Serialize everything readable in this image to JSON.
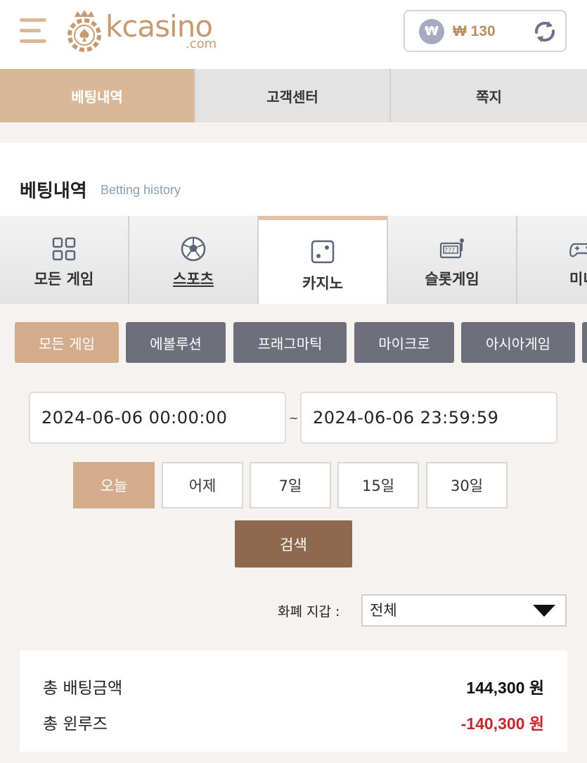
{
  "header": {
    "logo_text": "kcasino",
    "logo_sub": ".com",
    "wallet": {
      "currency_symbol": "₩",
      "amount": "₩ 130"
    }
  },
  "topnav": {
    "tabs": [
      {
        "label": "베팅내역",
        "active": true
      },
      {
        "label": "고객센터",
        "active": false
      },
      {
        "label": "쪽지",
        "active": false
      }
    ]
  },
  "section": {
    "title": "베팅내역",
    "subtitle": "Betting history"
  },
  "game_tabs": [
    {
      "label": "모든 게임",
      "icon": "grid-icon"
    },
    {
      "label": "스포츠",
      "icon": "soccer-ball-icon"
    },
    {
      "label": "카지노",
      "icon": "dice-icon",
      "active": true
    },
    {
      "label": "슬롯게임",
      "icon": "slot-machine-icon"
    },
    {
      "label": "미니",
      "icon": "gamepad-icon"
    }
  ],
  "providers": [
    {
      "label": "모든 게임",
      "active": true
    },
    {
      "label": "에볼루션"
    },
    {
      "label": "프래그마틱"
    },
    {
      "label": "마이크로"
    },
    {
      "label": "아시아게임"
    }
  ],
  "date_range": {
    "start": "2024-06-06 00:00:00",
    "separator": "~",
    "end": "2024-06-06 23:59:59"
  },
  "quick_dates": [
    {
      "label": "오늘",
      "active": true
    },
    {
      "label": "어제"
    },
    {
      "label": "7일"
    },
    {
      "label": "15일"
    },
    {
      "label": "30일"
    }
  ],
  "search_label": "검색",
  "currency": {
    "label": "화폐 지갑 :",
    "selected": "전체"
  },
  "summary": {
    "bet_label": "총 배팅금액",
    "bet_value": "144,300 원",
    "winloss_label": "총 윈루즈",
    "winloss_value": "-140,300 원"
  },
  "colors": {
    "accent": "#d3ac8b",
    "dark_button": "#6d6f7b",
    "search_button": "#8d6a4f",
    "negative": "#c4282e"
  }
}
